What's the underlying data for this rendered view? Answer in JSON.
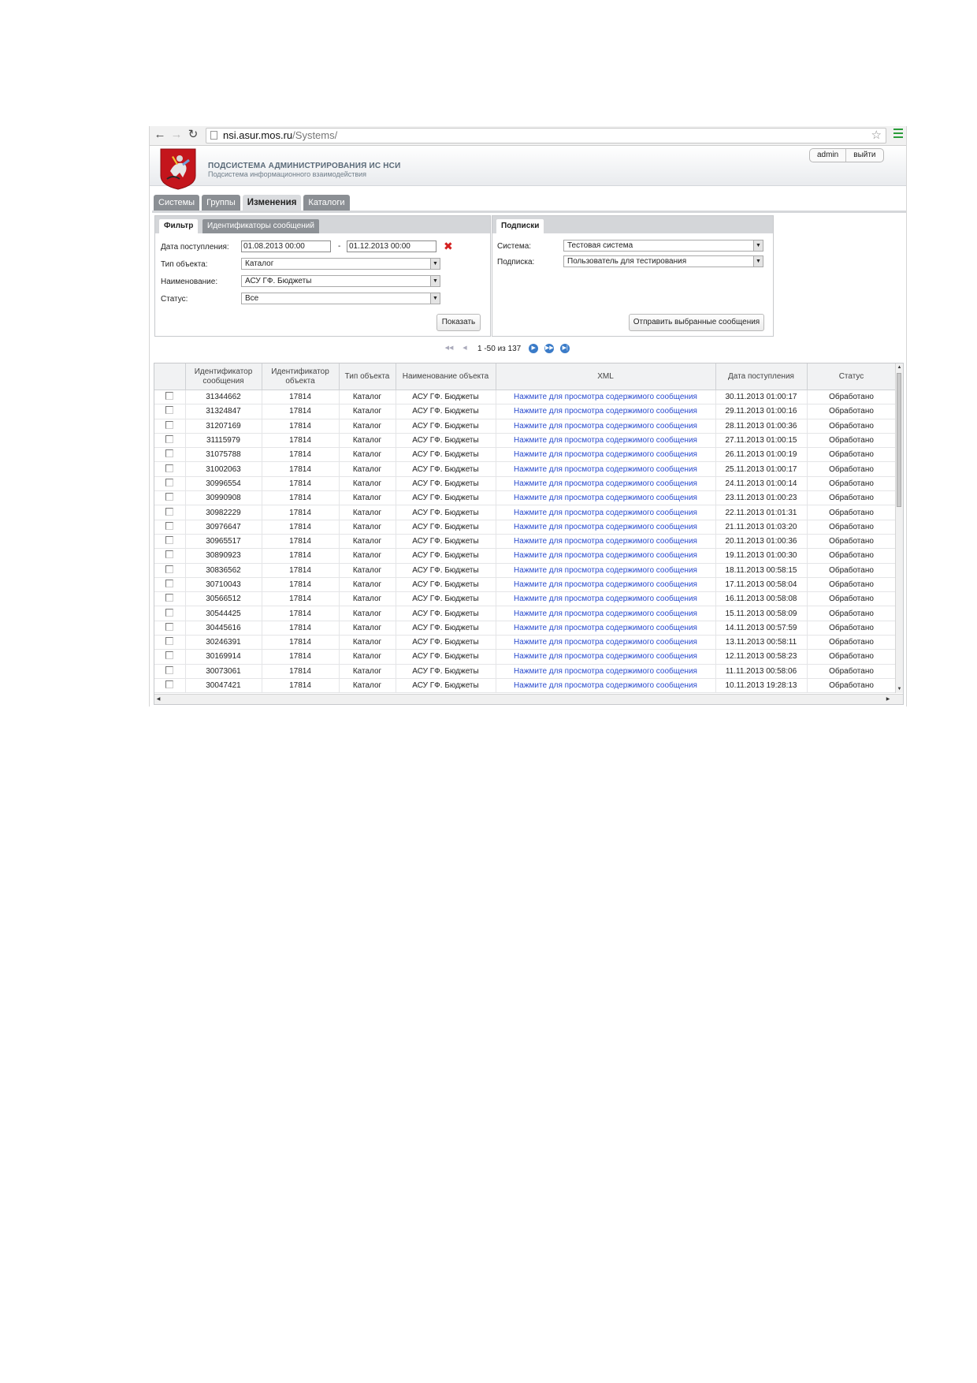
{
  "browser": {
    "url_host": "nsi.asur.mos.ru",
    "url_path": "/Systems/"
  },
  "header": {
    "title": "ПОДСИСТЕМА АДМИНИСТРИРОВАНИЯ ИС НСИ",
    "subtitle": "Подсистема информационного взаимодействия",
    "user": "admin",
    "logout": "выйти"
  },
  "main_tabs": [
    {
      "label": "Системы",
      "active": false
    },
    {
      "label": "Группы",
      "active": false
    },
    {
      "label": "Изменения",
      "active": true
    },
    {
      "label": "Каталоги",
      "active": false
    }
  ],
  "filter": {
    "tab_filter": "Фильтр",
    "tab_ids": "Идентификаторы сообщений",
    "date_label": "Дата поступления:",
    "date_from": "01.08.2013 00:00",
    "date_sep": "-",
    "date_to": "01.12.2013 00:00",
    "type_label": "Тип объекта:",
    "type_value": "Каталог",
    "name_label": "Наименование:",
    "name_value": "АСУ ГФ. Бюджеты",
    "status_label": "Статус:",
    "status_value": "Все",
    "show_button": "Показать"
  },
  "subscriptions": {
    "tab_label": "Подписки",
    "system_label": "Система:",
    "system_value": "Тестовая система",
    "sub_label": "Подписка:",
    "sub_value": "Пользователь для тестирования",
    "send_button": "Отправить выбранные сообщения"
  },
  "pager": {
    "text": "1 -50 из 137"
  },
  "table": {
    "headers": {
      "msg_id": "Идентификатор сообщения",
      "obj_id": "Идентификатор объекта",
      "obj_type": "Тип объекта",
      "obj_name": "Наименование объекта",
      "xml": "XML",
      "date": "Дата поступления",
      "status": "Статус"
    },
    "rows": [
      {
        "msg_id": "31344662",
        "obj_id": "17814",
        "type": "Каталог",
        "name": "АСУ ГФ. Бюджеты",
        "xml": "Нажмите для просмотра содержимого сообщения",
        "date": "30.11.2013 01:00:17",
        "status": "Обработано"
      },
      {
        "msg_id": "31324847",
        "obj_id": "17814",
        "type": "Каталог",
        "name": "АСУ ГФ. Бюджеты",
        "xml": "Нажмите для просмотра содержимого сообщения",
        "date": "29.11.2013 01:00:16",
        "status": "Обработано"
      },
      {
        "msg_id": "31207169",
        "obj_id": "17814",
        "type": "Каталог",
        "name": "АСУ ГФ. Бюджеты",
        "xml": "Нажмите для просмотра содержимого сообщения",
        "date": "28.11.2013 01:00:36",
        "status": "Обработано"
      },
      {
        "msg_id": "31115979",
        "obj_id": "17814",
        "type": "Каталог",
        "name": "АСУ ГФ. Бюджеты",
        "xml": "Нажмите для просмотра содержимого сообщения",
        "date": "27.11.2013 01:00:15",
        "status": "Обработано"
      },
      {
        "msg_id": "31075788",
        "obj_id": "17814",
        "type": "Каталог",
        "name": "АСУ ГФ. Бюджеты",
        "xml": "Нажмите для просмотра содержимого сообщения",
        "date": "26.11.2013 01:00:19",
        "status": "Обработано"
      },
      {
        "msg_id": "31002063",
        "obj_id": "17814",
        "type": "Каталог",
        "name": "АСУ ГФ. Бюджеты",
        "xml": "Нажмите для просмотра содержимого сообщения",
        "date": "25.11.2013 01:00:17",
        "status": "Обработано"
      },
      {
        "msg_id": "30996554",
        "obj_id": "17814",
        "type": "Каталог",
        "name": "АСУ ГФ. Бюджеты",
        "xml": "Нажмите для просмотра содержимого сообщения",
        "date": "24.11.2013 01:00:14",
        "status": "Обработано"
      },
      {
        "msg_id": "30990908",
        "obj_id": "17814",
        "type": "Каталог",
        "name": "АСУ ГФ. Бюджеты",
        "xml": "Нажмите для просмотра содержимого сообщения",
        "date": "23.11.2013 01:00:23",
        "status": "Обработано"
      },
      {
        "msg_id": "30982229",
        "obj_id": "17814",
        "type": "Каталог",
        "name": "АСУ ГФ. Бюджеты",
        "xml": "Нажмите для просмотра содержимого сообщения",
        "date": "22.11.2013 01:01:31",
        "status": "Обработано"
      },
      {
        "msg_id": "30976647",
        "obj_id": "17814",
        "type": "Каталог",
        "name": "АСУ ГФ. Бюджеты",
        "xml": "Нажмите для просмотра содержимого сообщения",
        "date": "21.11.2013 01:03:20",
        "status": "Обработано"
      },
      {
        "msg_id": "30965517",
        "obj_id": "17814",
        "type": "Каталог",
        "name": "АСУ ГФ. Бюджеты",
        "xml": "Нажмите для просмотра содержимого сообщения",
        "date": "20.11.2013 01:00:36",
        "status": "Обработано"
      },
      {
        "msg_id": "30890923",
        "obj_id": "17814",
        "type": "Каталог",
        "name": "АСУ ГФ. Бюджеты",
        "xml": "Нажмите для просмотра содержимого сообщения",
        "date": "19.11.2013 01:00:30",
        "status": "Обработано"
      },
      {
        "msg_id": "30836562",
        "obj_id": "17814",
        "type": "Каталог",
        "name": "АСУ ГФ. Бюджеты",
        "xml": "Нажмите для просмотра содержимого сообщения",
        "date": "18.11.2013 00:58:15",
        "status": "Обработано"
      },
      {
        "msg_id": "30710043",
        "obj_id": "17814",
        "type": "Каталог",
        "name": "АСУ ГФ. Бюджеты",
        "xml": "Нажмите для просмотра содержимого сообщения",
        "date": "17.11.2013 00:58:04",
        "status": "Обработано"
      },
      {
        "msg_id": "30566512",
        "obj_id": "17814",
        "type": "Каталог",
        "name": "АСУ ГФ. Бюджеты",
        "xml": "Нажмите для просмотра содержимого сообщения",
        "date": "16.11.2013 00:58:08",
        "status": "Обработано"
      },
      {
        "msg_id": "30544425",
        "obj_id": "17814",
        "type": "Каталог",
        "name": "АСУ ГФ. Бюджеты",
        "xml": "Нажмите для просмотра содержимого сообщения",
        "date": "15.11.2013 00:58:09",
        "status": "Обработано"
      },
      {
        "msg_id": "30445616",
        "obj_id": "17814",
        "type": "Каталог",
        "name": "АСУ ГФ. Бюджеты",
        "xml": "Нажмите для просмотра содержимого сообщения",
        "date": "14.11.2013 00:57:59",
        "status": "Обработано"
      },
      {
        "msg_id": "30246391",
        "obj_id": "17814",
        "type": "Каталог",
        "name": "АСУ ГФ. Бюджеты",
        "xml": "Нажмите для просмотра содержимого сообщения",
        "date": "13.11.2013 00:58:11",
        "status": "Обработано"
      },
      {
        "msg_id": "30169914",
        "obj_id": "17814",
        "type": "Каталог",
        "name": "АСУ ГФ. Бюджеты",
        "xml": "Нажмите для просмотра содержимого сообщения",
        "date": "12.11.2013 00:58:23",
        "status": "Обработано"
      },
      {
        "msg_id": "30073061",
        "obj_id": "17814",
        "type": "Каталог",
        "name": "АСУ ГФ. Бюджеты",
        "xml": "Нажмите для просмотра содержимого сообщения",
        "date": "11.11.2013 00:58:06",
        "status": "Обработано"
      },
      {
        "msg_id": "30047421",
        "obj_id": "17814",
        "type": "Каталог",
        "name": "АСУ ГФ. Бюджеты",
        "xml": "Нажмите для просмотра содержимого сообщения",
        "date": "10.11.2013 19:28:13",
        "status": "Обработано"
      }
    ]
  },
  "colors": {
    "link": "#2b4ccf",
    "tab_inactive": "#8b8f94",
    "clear_icon": "#d42020",
    "pager_active": "#3a7bc8"
  },
  "icons": {
    "back": "back-arrow-icon",
    "forward": "forward-arrow-icon",
    "reload": "reload-icon",
    "bookmark": "star-icon",
    "menu": "menu-icon",
    "logo": "moscow-coat-of-arms-icon",
    "clear": "clear-date-icon",
    "pager": [
      "first-page-icon",
      "prev-page-icon",
      "next-page-icon",
      "fast-forward-icon",
      "last-page-icon"
    ]
  }
}
